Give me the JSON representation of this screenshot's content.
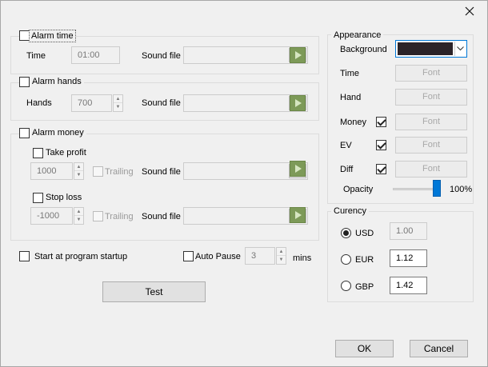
{
  "alarm_time": {
    "label": "Alarm time",
    "checked": false,
    "time_label": "Time",
    "time_value": "01:00",
    "sound_label": "Sound file",
    "sound_value": ""
  },
  "alarm_hands": {
    "label": "Alarm hands",
    "checked": false,
    "hands_label": "Hands",
    "hands_value": "700",
    "sound_label": "Sound file",
    "sound_value": ""
  },
  "alarm_money": {
    "label": "Alarm money",
    "checked": false,
    "take_profit": {
      "label": "Take profit",
      "checked": false,
      "value": "1000",
      "trailing_label": "Trailing",
      "sound_label": "Sound file",
      "sound_value": ""
    },
    "stop_loss": {
      "label": "Stop loss",
      "checked": false,
      "value": "-1000",
      "trailing_label": "Trailing",
      "sound_label": "Sound file",
      "sound_value": ""
    }
  },
  "startup": {
    "label": "Start at program startup",
    "checked": false
  },
  "auto_pause": {
    "label": "Auto Pause",
    "checked": false,
    "value": "3",
    "unit": "mins"
  },
  "test_button": "Test",
  "appearance": {
    "title": "Appearance",
    "background_label": "Background",
    "background_color": "#2b2328",
    "time_label": "Time",
    "hand_label": "Hand",
    "money_label": "Money",
    "ev_label": "EV",
    "diff_label": "Diff",
    "font_label": "Font",
    "money_checked": true,
    "ev_checked": true,
    "diff_checked": true,
    "opacity_label": "Opacity",
    "opacity_value": "100%",
    "opacity_fraction": 1.0
  },
  "currency": {
    "title": "Curency",
    "selected": "USD",
    "usd_label": "USD",
    "usd_value": "1.00",
    "eur_label": "EUR",
    "eur_value": "1.12",
    "gbp_label": "GBP",
    "gbp_value": "1.42"
  },
  "footer": {
    "ok": "OK",
    "cancel": "Cancel"
  },
  "colors": {
    "accent": "#0078d7",
    "play_green": "#7d9a58"
  }
}
